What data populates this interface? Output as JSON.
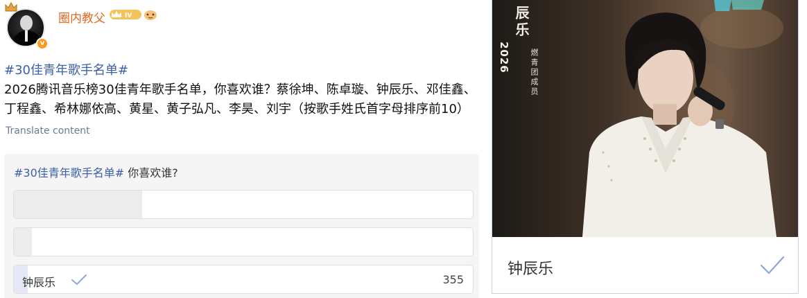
{
  "post": {
    "username": "圈内教父",
    "level_badge": "IV",
    "verified_badge": "v",
    "hashtag": "#30佳青年歌手名单#",
    "body": "2026腾讯音乐榜30佳青年歌手名单，你喜欢谁？蔡徐坤、陈卓璇、钟辰乐、邓佳鑫、丁程鑫、希林娜依高、黄星、黄子弘凡、李昊、刘宇（按歌手姓氏首字母排序前10）",
    "translate_label": "Translate content"
  },
  "poll": {
    "question_tag": "#30佳青年歌手名单#",
    "question_text": " 你喜欢谁?",
    "options": [
      {
        "label": "",
        "count": "",
        "fill_fraction": 0.28,
        "selected": false
      },
      {
        "label": "",
        "count": "",
        "fill_fraction": 0.04,
        "selected": false
      },
      {
        "label": "钟辰乐",
        "count": "355",
        "fill_fraction": 0.03,
        "selected": true
      }
    ]
  },
  "card": {
    "photo_caption_name": "辰乐",
    "photo_caption_sub": "燃青团成员",
    "photo_caption_year": "2026",
    "name": "钟辰乐"
  },
  "colors": {
    "hashtag": "#3b5fa6",
    "username": "#e06a1f",
    "check": "#8fa6dd",
    "poll_bg": "#f5f5f5"
  },
  "icons": [
    "crown-icon",
    "level-badge-icon",
    "emoji-icon",
    "verified-icon",
    "check-icon"
  ]
}
